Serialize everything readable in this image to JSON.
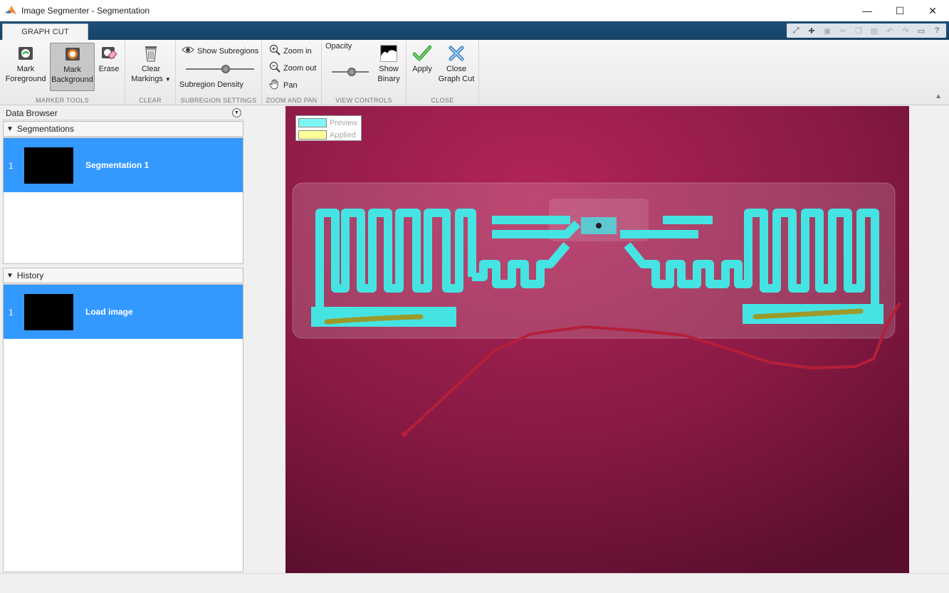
{
  "window": {
    "title": "Image Segmenter - Segmentation",
    "minimize": "—",
    "maximize": "☐",
    "close": "✕"
  },
  "tabs": {
    "active": "GRAPH CUT"
  },
  "ribbon": {
    "marker_tools": {
      "label": "MARKER TOOLS",
      "mark_foreground_1": "Mark",
      "mark_foreground_2": "Foreground",
      "mark_background_1": "Mark",
      "mark_background_2": "Background",
      "erase": "Erase"
    },
    "clear": {
      "label": "CLEAR",
      "clear_markings_1": "Clear",
      "clear_markings_2": "Markings"
    },
    "subregion_settings": {
      "label": "SUBREGION SETTINGS",
      "show_subregions": "Show Subregions",
      "subregion_density": "Subregion Density",
      "density_value": 0.6
    },
    "zoom_and_pan": {
      "label": "ZOOM AND PAN",
      "zoom_in": "Zoom in",
      "zoom_out": "Zoom out",
      "pan": "Pan"
    },
    "view_controls": {
      "label": "VIEW CONTROLS",
      "opacity": "Opacity",
      "opacity_value": 0.55,
      "show_binary_1": "Show",
      "show_binary_2": "Binary"
    },
    "close": {
      "label": "CLOSE",
      "apply": "Apply",
      "close_graph_cut_1": "Close",
      "close_graph_cut_2": "Graph Cut"
    }
  },
  "data_browser": {
    "title": "Data Browser",
    "segmentations": {
      "header": "Segmentations",
      "items": [
        {
          "index": "1",
          "label": "Segmentation 1"
        }
      ]
    },
    "history": {
      "header": "History",
      "items": [
        {
          "index": "1",
          "label": "Load image"
        }
      ]
    }
  },
  "legend": {
    "preview": "Preview",
    "applied": "Applied",
    "preview_color": "#7ff6f6",
    "applied_color": "#ffff99"
  },
  "colors": {
    "accent_selection": "#3399ff",
    "ribbon_tab_bar": "#1d4f7a",
    "foreground_mark": "#3ee0e0",
    "background_mark": "#c0233a"
  }
}
